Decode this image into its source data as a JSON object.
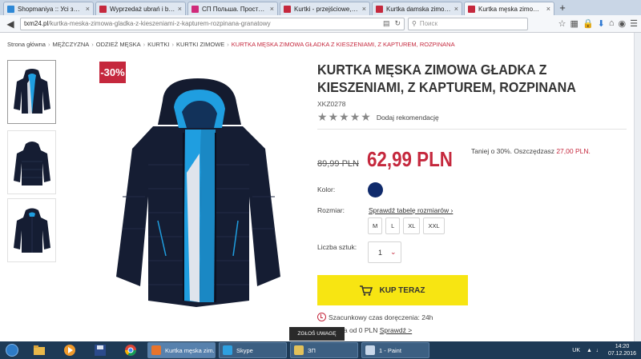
{
  "browser": {
    "tabs": [
      {
        "label": "Shopmaniya :: Усі замов...",
        "favicon_color": "#2e88d6",
        "active": false
      },
      {
        "label": "Wyprzedaż ubrań i butó...",
        "favicon_color": "#c5283d",
        "active": false
      },
      {
        "label": "СП Польша. Простые ...",
        "favicon_color": "#d02a7a",
        "active": false
      },
      {
        "label": "Kurtki - przejściowe, oci...",
        "favicon_color": "#c5283d",
        "active": false
      },
      {
        "label": "Kurtka damska zimowa ...",
        "favicon_color": "#c5283d",
        "active": false
      },
      {
        "label": "Kurtka męska zimowa gł...",
        "favicon_color": "#c5283d",
        "active": true
      }
    ],
    "new_tab": "+",
    "url_domain": "txm24.pl",
    "url_path": "/kurtka-meska-zimowa-gladka-z-kieszeniami-z-kapturem-rozpinana-granatowy",
    "search_placeholder": "Поиск"
  },
  "breadcrumb": [
    "Strona główna",
    "MĘŻCZYZNA",
    "ODZIEŻ MĘSKA",
    "KURTKI",
    "KURTKI ZIMOWE"
  ],
  "breadcrumb_current": "KURTKA MĘSKA ZIMOWA GŁADKA Z KIESZENIAMI, Z KAPTUREM, ROZPINANA",
  "product": {
    "discount_badge": "-30%",
    "title": "KURTKA MĘSKA ZIMOWA GŁADKA Z KIESZENIAMI, Z KAPTUREM, ROZPINANA",
    "sku": "XKZ0278",
    "rating_stars": 5,
    "add_review": "Dodaj rekomendację",
    "old_price": "89,99 PLN",
    "new_price": "62,99 PLN",
    "savings_text": "Taniej o 30%. Oszczędzasz ",
    "savings_amount": "27,00 PLN.",
    "color_label": "Kolor:",
    "color_hex": "#0f2a6b",
    "size_label": "Rozmiar:",
    "size_table_link": "Sprawdź tabelę rozmiarów ›",
    "sizes": [
      "M",
      "L",
      "XL",
      "XXL"
    ],
    "qty_label": "Liczba sztuk:",
    "qty_value": "1",
    "buy_label": "KUP TERAZ",
    "delivery_text": "Szacunkowy czas doręczenia: 24h",
    "shipping_text": "awa od 0 PLN ",
    "shipping_link": "Sprawdź >"
  },
  "report_button": "ZGŁOŚ UWAGĘ",
  "taskbar": {
    "tasks": [
      {
        "label": "Kurtka męska zim...",
        "icon_color": "#e8742c",
        "active": true
      },
      {
        "label": "Skype",
        "icon_color": "#2ea0e0",
        "active": false
      },
      {
        "label": "ЗП",
        "icon_color": "#e2c15a",
        "active": false
      },
      {
        "label": "1 - Paint",
        "icon_color": "#c9d8ea",
        "active": false
      }
    ],
    "lang": "UK",
    "time": "14:20",
    "date": "07.12.2016"
  },
  "colors": {
    "accent": "#c5283d",
    "buy_button": "#f7e512",
    "jacket": "#151d33",
    "lining": "#1f9ee0"
  }
}
